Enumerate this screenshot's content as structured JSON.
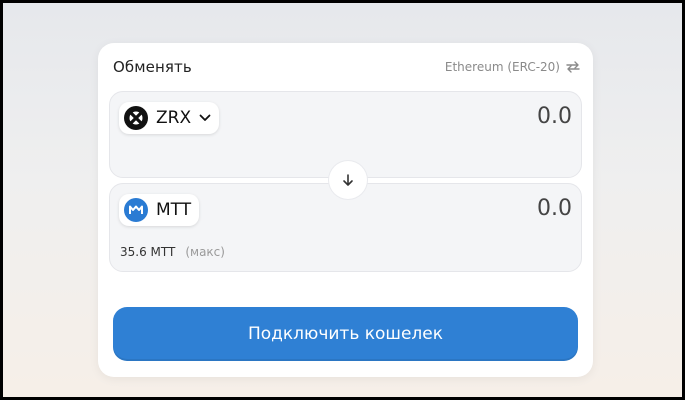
{
  "card": {
    "title": "Обменять",
    "network_label": "Ethereum (ERC-20)",
    "network_icon": "swap-horizontal-icon"
  },
  "from": {
    "token_symbol": "ZRX",
    "token_icon": "zrx-logo-icon",
    "amount": "0.0",
    "dropdown_icon": "chevron-down-icon"
  },
  "swap": {
    "icon": "arrow-down-icon"
  },
  "to": {
    "token_symbol": "MTT",
    "token_icon": "mtt-logo-icon",
    "amount": "0.0",
    "balance": "35.6 MTT",
    "max_label": "(макс)"
  },
  "action": {
    "connect_label": "Подключить кошелек"
  },
  "colors": {
    "accent": "#2f80d4",
    "mtt_brand": "#2a7bd3",
    "card_bg": "#ffffff",
    "panel_bg": "#f4f5f7"
  }
}
